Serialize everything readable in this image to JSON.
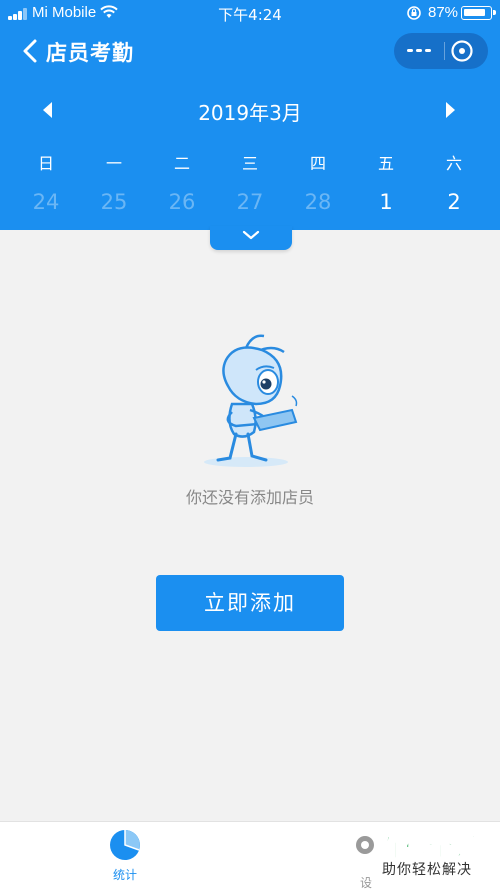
{
  "status_bar": {
    "carrier": "Mi Mobile",
    "time": "下午4:24",
    "battery_percent": "87%",
    "battery_level": 0.87
  },
  "nav": {
    "title": "店员考勤"
  },
  "calendar": {
    "month_label": "2019年3月",
    "weekdays": [
      "日",
      "一",
      "二",
      "三",
      "四",
      "五",
      "六"
    ],
    "dates": [
      {
        "label": "24",
        "current_month": false
      },
      {
        "label": "25",
        "current_month": false
      },
      {
        "label": "26",
        "current_month": false
      },
      {
        "label": "27",
        "current_month": false
      },
      {
        "label": "28",
        "current_month": false
      },
      {
        "label": "1",
        "current_month": true
      },
      {
        "label": "2",
        "current_month": true
      }
    ]
  },
  "empty_state": {
    "message": "你还没有添加店员",
    "add_button_label": "立即添加"
  },
  "tab_bar": {
    "tabs": [
      {
        "label": "统计",
        "icon": "pie-chart-icon",
        "active": true
      },
      {
        "label": "设置",
        "icon": "gear-icon",
        "active": false
      }
    ]
  },
  "watermark": {
    "logo_text": "百科全说",
    "tagline": "助你轻松解决"
  },
  "colors": {
    "primary": "#1b8ff0",
    "capsule": "#1670c9",
    "background": "#f2f2f2",
    "muted_text": "#888888",
    "watermark_green": "#14a046"
  }
}
